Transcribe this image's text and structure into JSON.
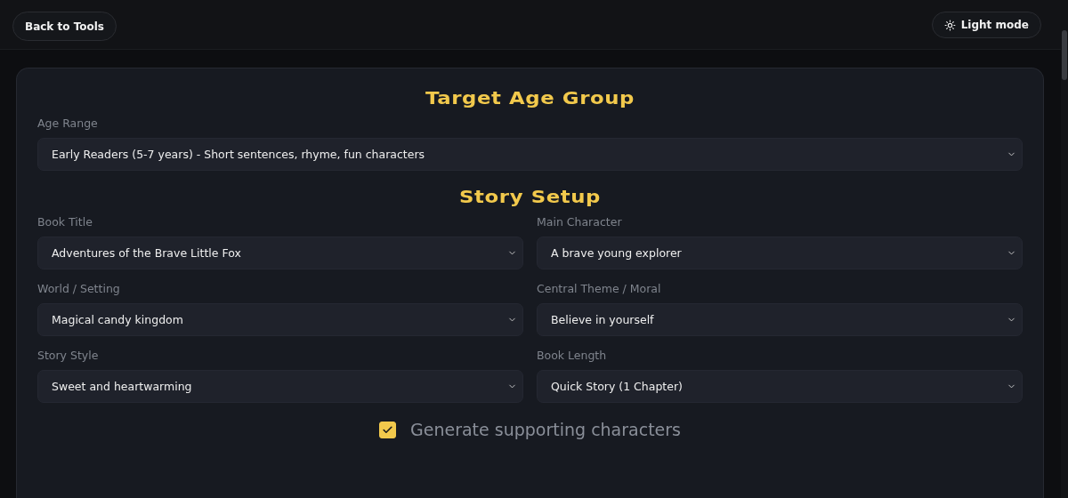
{
  "header": {
    "back_button": "Back to Tools",
    "theme_button": "Light mode"
  },
  "age_section": {
    "title": "Target Age Group",
    "field": {
      "label": "Age Range",
      "value": "Early Readers (5-7 years) - Short sentences, rhyme, fun characters"
    }
  },
  "story_section": {
    "title": "Story Setup",
    "fields": [
      {
        "label": "Book Title",
        "value": "Adventures of the Brave Little Fox"
      },
      {
        "label": "Main Character",
        "value": "A brave young explorer"
      },
      {
        "label": "World / Setting",
        "value": "Magical candy kingdom"
      },
      {
        "label": "Central Theme / Moral",
        "value": "Believe in yourself"
      },
      {
        "label": "Story Style",
        "value": "Sweet and heartwarming"
      },
      {
        "label": "Book Length",
        "value": "Quick Story (1 Chapter)"
      }
    ]
  },
  "supporting_characters": {
    "label": "Generate supporting characters",
    "checked": true
  }
}
